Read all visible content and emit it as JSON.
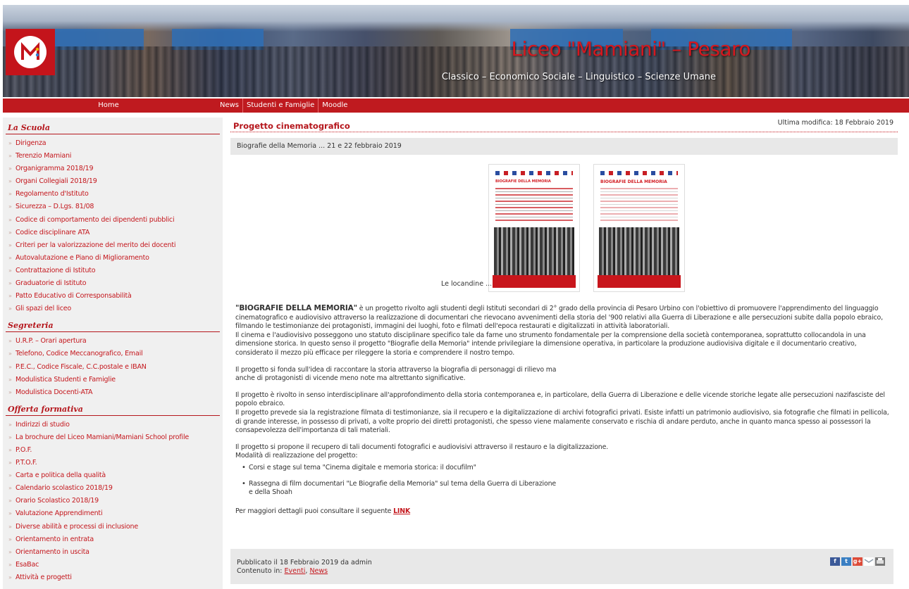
{
  "header": {
    "title": "Liceo \"Mamiani\" – Pesaro",
    "subtitle": "Classico – Economico Sociale – Linguistico – Scienze Umane"
  },
  "nav": {
    "home": "Home",
    "items": [
      "News",
      "Studenti e Famiglie",
      "Moodle"
    ]
  },
  "sidebar": {
    "sections": [
      {
        "title": "La Scuola",
        "items": [
          "Dirigenza",
          "Terenzio Mamiani",
          "Organigramma 2018/19",
          "Organi Collegiali 2018/19",
          "Regolamento d'Istituto",
          "Sicurezza – D.Lgs. 81/08",
          "Codice di comportamento dei dipendenti pubblici",
          "Codice disciplinare ATA",
          "Criteri per la valorizzazione del merito dei docenti",
          "Autovalutazione e Piano di Miglioramento",
          "Contrattazione di Istituto",
          "Graduatorie di Istituto",
          "Patto Educativo di Corresponsabilità",
          "Gli spazi del liceo"
        ]
      },
      {
        "title": "Segreteria",
        "items": [
          "U.R.P. – Orari apertura",
          "Telefono, Codice Meccanografico, Email",
          "P.E.C., Codice Fiscale, C.C.postale e IBAN",
          "Modulistica Studenti e Famiglie",
          "Modulistica Docenti-ATA"
        ]
      },
      {
        "title": "Offerta formativa",
        "items": [
          "Indirizzi di studio",
          "La brochure del Liceo Mamiani/Mamiani School profile",
          "P.O.F.",
          "P.T.O.F.",
          "Carta e politica della qualità",
          "Calendario scolastico 2018/19",
          "Orario Scolastico 2018/19",
          "Valutazione Apprendimenti",
          "Diverse abilità e processi di inclusione",
          "Orientamento in entrata",
          "Orientamento in uscita",
          "EsaBac",
          "Attività e progetti"
        ]
      }
    ]
  },
  "post": {
    "title": "Progetto cinematografico",
    "last_modified": "Ultima modifica: 18 Febbraio 2019",
    "subtitle": "Biografie della Memoria ... 21 e 22 febbraio 2019",
    "poster_caption": "Le locandine ...",
    "poster_heading_1": "BIOGRAFIE DELLA MEMORIA",
    "poster_heading_2": "BIOGRAFIE DELLA MEMORIA",
    "intro_bold": "\"BIOGRAFIE DELLA MEMORIA\"",
    "intro_rest": " è un progetto rivolto agli studenti degli Istituti secondari di 2° grado della provincia di Pesaro Urbino con l'obiettivo di promuovere l'apprendimento del linguaggio cinematografico e audiovisivo attraverso la realizzazione di documentari che rievocano avvenimenti della storia del '900 relativi alla Guerra di Liberazione e alle persecuzioni subite dalla popolo ebraico, filmando le testimonianze dei protagonisti, immagini dei luoghi, foto e filmati dell'epoca restaurati e digitalizzati in attività laboratoriali.",
    "para_2": "Il cinema e l'audiovisivo posseggono uno statuto disciplinare specifico tale da farne uno strumento fondamentale per la comprensione della società contemporanea, soprattutto collocandola in una dimensione storica. In questo senso il progetto \"Biografie della Memoria\" intende privilegiare  la dimensione operativa, in particolare la produzione audiovisiva digitale e il documentario creativo, considerato il mezzo più efficace per rileggere la storia e comprendere il nostro tempo.",
    "para_3a": "Il progetto si fonda sull'idea di raccontare la storia attraverso la biografia di personaggi di rilievo ma",
    "para_3b": "anche di protagonisti di vicende meno note ma altrettanto significative.",
    "para_4": "Il progetto è rivolto in senso interdisciplinare all'approfondimento della storia contemporanea e, in particolare, della Guerra di Liberazione e delle vicende storiche legate alle persecuzioni nazifasciste del popolo ebraico.",
    "para_5": "Il progetto prevede sia la registrazione filmata di testimonianze, sia il recupero e la digitalizzazione di archivi fotografici privati. Esiste infatti un patrimonio audiovisivo, sia fotografie che filmati in pellicola, di grande interesse, in possesso di privati, a volte proprio dei diretti protagonisti, che spesso viene malamente conservato e rischia di andare perduto, anche in quanto manca spesso ai possessori la consapevolezza dell'importanza di tali materiali.",
    "para_6": "Il progetto si propone il recupero di tali documenti fotografici e audiovisivi attraverso il restauro e la digitalizzazione.",
    "para_7": "Modalità di realizzazione del progetto:",
    "bullets": [
      "Corsi e stage sul tema \"Cinema digitale e memoria storica: il docufilm\"",
      "Rassegna di film documentari \"Le Biografie della Memoria\" sul tema della Guerra di Liberazione"
    ],
    "bullet_2_cont": "e della Shoah",
    "more_text": "Per maggiori dettagli puoi consultare il seguente ",
    "more_link": "LINK",
    "published": "Pubblicato il 18 Febbraio 2019 da admin",
    "content_in_label": "Contenuto in: ",
    "category_1": "Eventi",
    "category_sep": ", ",
    "category_2": "News"
  },
  "share_icons": [
    "facebook-icon",
    "twitter-icon",
    "google-plus-icon",
    "email-icon",
    "print-icon"
  ],
  "colors": {
    "accent": "#c4161c",
    "navbar": "#bf1a1f",
    "sidebar_bg": "#f0f0f0"
  }
}
